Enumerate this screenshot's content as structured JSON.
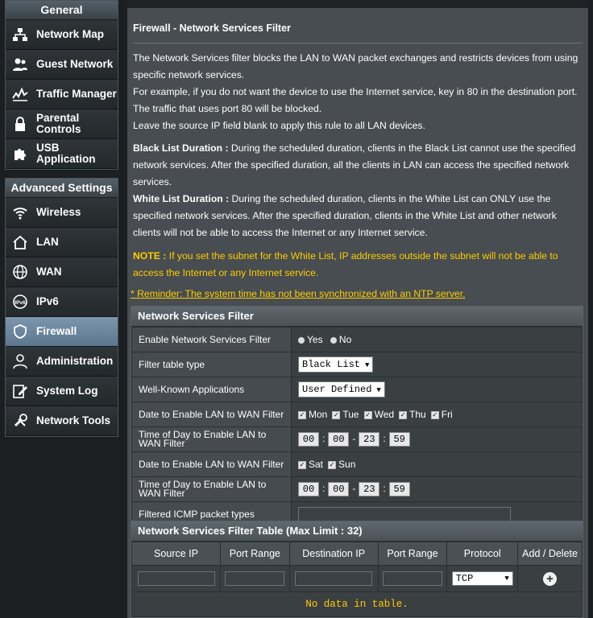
{
  "sidebar": {
    "general_title": "General",
    "general_items": [
      {
        "label": "Network Map",
        "icon": "network-map-icon"
      },
      {
        "label": "Guest Network",
        "icon": "guest-network-icon"
      },
      {
        "label": "Traffic Manager",
        "icon": "traffic-manager-icon"
      },
      {
        "label": "Parental Controls",
        "icon": "lock-icon"
      },
      {
        "label": "USB Application",
        "icon": "puzzle-icon"
      }
    ],
    "advanced_title": "Advanced Settings",
    "advanced_items": [
      {
        "label": "Wireless",
        "icon": "wifi-icon"
      },
      {
        "label": "LAN",
        "icon": "home-icon"
      },
      {
        "label": "WAN",
        "icon": "globe-icon"
      },
      {
        "label": "IPv6",
        "icon": "ipv6-icon"
      },
      {
        "label": "Firewall",
        "icon": "shield-icon",
        "active": true
      },
      {
        "label": "Administration",
        "icon": "user-icon"
      },
      {
        "label": "System Log",
        "icon": "edit-log-icon"
      },
      {
        "label": "Network Tools",
        "icon": "tools-icon"
      }
    ]
  },
  "page": {
    "title": "Firewall - Network Services Filter",
    "desc1": "The Network Services filter blocks the LAN to WAN packet exchanges and restricts devices from using specific network services.",
    "desc2": "For example, if you do not want the device to use the Internet service, key in 80 in the destination port. The traffic that uses port 80 will be blocked.",
    "desc3": "Leave the source IP field blank to apply this rule to all LAN devices.",
    "black_label": "Black List Duration :",
    "black_text": " During the scheduled duration, clients in the Black List cannot use the specified network services. After the specified duration, all the clients in LAN can access the specified network services.",
    "white_label": "White List Duration :",
    "white_text": " During the scheduled duration, clients in the White List can ONLY use the specified network services. After the specified duration, clients in the White List and other network clients will not be able to access the Internet or any Internet service.",
    "note_label": "NOTE :",
    "note_text": " If you set the subnet for the White List, IP addresses outside the subnet will not be able to access the Internet or any Internet service.",
    "reminder": "* Reminder: The system time has not been synchronized with an NTP server."
  },
  "filter": {
    "header": "Network Services Filter",
    "enable_label": "Enable Network Services Filter",
    "yes": "Yes",
    "no": "No",
    "filter_type_label": "Filter table type",
    "filter_type_value": "Black List",
    "well_known_label": "Well-Known Applications",
    "well_known_value": "User Defined",
    "date1_label": "Date to Enable LAN to WAN Filter",
    "weekdays": [
      "Mon",
      "Tue",
      "Wed",
      "Thu",
      "Fri"
    ],
    "time1_label": "Time of Day to Enable LAN to WAN Filter",
    "time1": [
      "00",
      "00",
      "23",
      "59"
    ],
    "date2_label": "Date to Enable LAN to WAN Filter",
    "weekend": [
      "Sat",
      "Sun"
    ],
    "time2_label": "Time of Day to Enable LAN to WAN Filter",
    "time2": [
      "00",
      "00",
      "23",
      "59"
    ],
    "icmp_label": "Filtered ICMP packet types"
  },
  "rules_table": {
    "header": "Network Services Filter Table (Max Limit : 32)",
    "columns": [
      "Source IP",
      "Port Range",
      "Destination IP",
      "Port Range",
      "Protocol",
      "Add / Delete"
    ],
    "protocol_value": "TCP",
    "empty_text": "No data in table."
  }
}
